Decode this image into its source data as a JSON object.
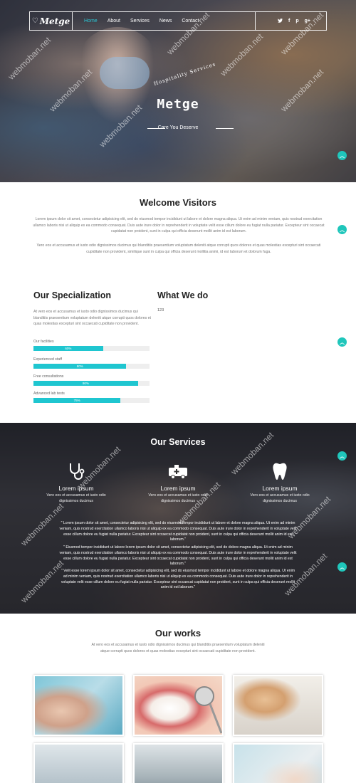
{
  "nav": {
    "logo": "Metge",
    "links": [
      {
        "label": "Home",
        "active": true
      },
      {
        "label": "About"
      },
      {
        "label": "Services"
      },
      {
        "label": "News"
      },
      {
        "label": "Contact"
      }
    ],
    "social": [
      "twitter-icon",
      "facebook-icon",
      "pinterest-icon",
      "google-plus-icon"
    ]
  },
  "hero": {
    "arc_text": "Hospitality Services",
    "title": "Metge",
    "tagline": "Care You Deserve"
  },
  "welcome": {
    "title": "Welcome Visitors",
    "p1": "Lorem ipsum dolor sit amet, consectetur adipisicing elit, sed do eiusmod tempor incididunt ut labore et dolore magna aliqua. Ut enim ad minim veniam, quis nostrud exercitation ullamco laboris nisi ut aliquip ex ea commodo consequat. Duis aute irure dolor in reprehenderit in voluptate velit esse cillum dolore eu fugiat nulla pariatur. Excepteur sint occaecat cupidatat non proident, sunt in culpa qui officia deserunt mollit anim id est laborum.",
    "p2": "Vero eos et accusamus et iusto odio dignissimos ducimus qui blanditiis praesentium voluptatum deleniti atque corrupti quos dolores et quas molestias excepturi sint occaecati cupiditate non provident, similique sunt in culpa qui officia deserunt mollitia animi, id est laborum et dolorum fuga."
  },
  "specialization": {
    "title": "Our Specialization",
    "text": "At vero eos et accusamus et iusto odio dignissimos ducimus qui blanditiis praesentium voluptatum deleniti atque corrupti quos dolores et quas molestias excepturi sint occaecati cupiditate non provident.",
    "bars": [
      {
        "label": "Our facilities",
        "value": 60,
        "text": "60%"
      },
      {
        "label": "Experienced staff",
        "value": 80,
        "text": "80%"
      },
      {
        "label": "Free consultations",
        "value": 90,
        "text": "90%"
      },
      {
        "label": "Advanced lab tests",
        "value": 75,
        "text": "75%"
      }
    ]
  },
  "what_we_do": {
    "title": "What We do",
    "text": "123"
  },
  "services": {
    "title": "Our Services",
    "items": [
      {
        "icon": "stethoscope-icon",
        "name": "Lorem ipsum",
        "desc": "Vero eos et accusamus et iusto odio dignissimos ducimus"
      },
      {
        "icon": "ambulance-icon",
        "name": "Lorem ipsum",
        "desc": "Vero eos et accusamus et iusto odio dignissimos ducimus"
      },
      {
        "icon": "tooth-icon",
        "name": "Lorem ipsum",
        "desc": "Vero eos et accusamus et iusto odio dignissimos ducimus"
      }
    ],
    "quotes": [
      "\" Lorem ipsum dolor sit amet, consectetur adipisicing elit, sed do eiusmod tempor incididunt ut labore et dolore magna aliqua. Ut enim ad minim veniam, quis nostrud exercitation ullamco laboris nisi ut aliquip ex ea commodo consequat. Duis aute irure dolor in reprehenderit in voluptate velit esse cillum dolore eu fugiat nulla pariatur. Excepteur sint occaecat cupidatat non proident, sunt in culpa qui officia deserunt mollit anim id est laborum.\"",
      "\" Eiusmod tempor incididunt ut labore lorem ipsum dolor sit amet, consectetur adipisicing elit, sed do dolore magna aliqua. Ut enim ad minim veniam, quis nostrud exercitation ullamco laboris nisi ut aliquip ex ea commodo consequat. Duis aute irure dolor in reprehenderit in voluptate velit esse cillum dolore eu fugiat nulla pariatur. Excepteur sint occaecat cupidatat non proident, sunt in culpa qui officia deserunt mollit anim id est laborum.\"",
      "\" Velit esse lorem ipsum dolor sit amet, consectetur adipisicing elit, sed do eiusmod tempor incididunt ut labore et dolore magna aliqua. Ut enim ad minim veniam, quis nostrud exercitation ullamco laboris nisi ut aliquip ex ea commodo consequat. Duis aute irure dolor in reprehenderit in voluptate velit esse cillum dolore eu fugiat nulla pariatur. Excepteur sint occaecat cupidatat non proident, sunt in culpa qui officia deserunt mollit anim id est laborum.\""
    ]
  },
  "works": {
    "title": "Our works",
    "text": "At vero eos et accusamus et iusto odio dignissimos ducimus qui blanditiis praesentium voluptatum deleniti atque corrupti quos dolores et quas molestias excepturi sint occaecati cupiditate non provident."
  },
  "watermark": "webmoban.net",
  "colors": {
    "accent": "#1fc6d0",
    "nav_active": "#2cc6d4"
  }
}
